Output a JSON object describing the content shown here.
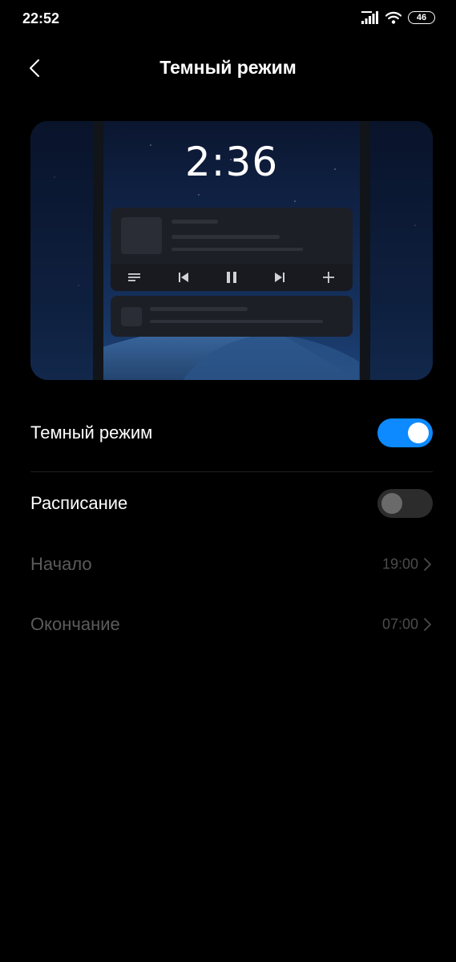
{
  "status_bar": {
    "time": "22:52",
    "battery": "46",
    "icons": [
      "signal-icon",
      "wifi-icon",
      "battery-icon"
    ]
  },
  "header": {
    "title": "Темный режим",
    "back_icon": "chevron-left-icon"
  },
  "preview": {
    "clock": "2:36",
    "media_controls": [
      "playlist-icon",
      "previous-icon",
      "pause-icon",
      "next-icon",
      "add-icon"
    ]
  },
  "settings": {
    "dark_mode": {
      "label": "Темный режим",
      "enabled": true
    },
    "schedule": {
      "label": "Расписание",
      "enabled": false
    },
    "start": {
      "label": "Начало",
      "value": "19:00"
    },
    "end": {
      "label": "Окончание",
      "value": "07:00"
    }
  },
  "colors": {
    "background": "#000000",
    "accent": "#0d8aff",
    "text_primary": "#ffffff",
    "text_disabled": "#5b5b5b"
  }
}
